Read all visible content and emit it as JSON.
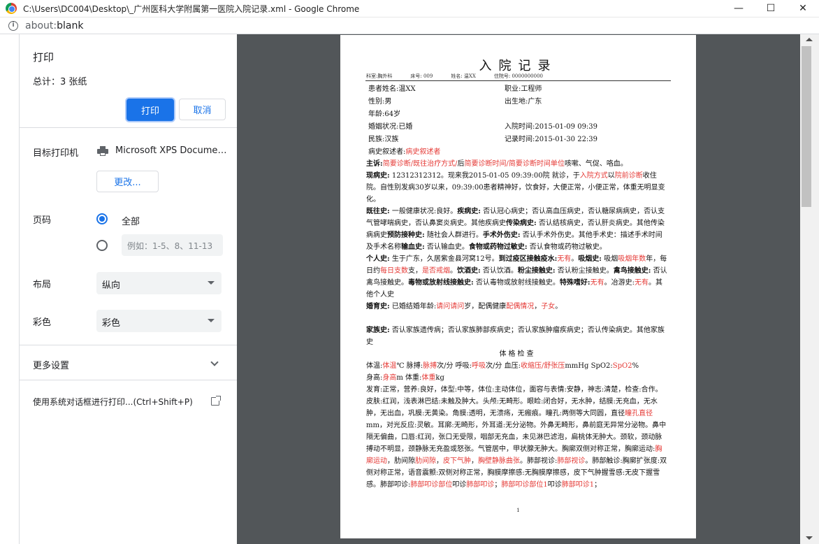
{
  "window": {
    "title": "C:\\Users\\DC004\\Desktop\\_广州医科大学附属第一医院入院记录.xml - Google Chrome",
    "minimize": "—",
    "maximize": "☐",
    "close": "✕"
  },
  "address": {
    "scheme": "about:",
    "path": "blank"
  },
  "print_panel": {
    "title": "打印",
    "total": "总计：3 张纸",
    "print_button": "打印",
    "cancel_button": "取消",
    "destination_label": "目标打印机",
    "printer_name": "Microsoft XPS Document Writer",
    "change_button": "更改...",
    "pages_label": "页码",
    "pages_all": "全部",
    "pages_placeholder": "例如：1-5、8、11-13",
    "layout_label": "布局",
    "layout_value": "纵向",
    "color_label": "彩色",
    "color_value": "彩色",
    "more_settings": "更多设置",
    "system_dialog": "使用系统对话框进行打印...(Ctrl+Shift+P)"
  },
  "document": {
    "title": "入院记录",
    "meta": [
      "科室:胸外科",
      "床号: 009",
      "姓名: 温XX",
      "住院号: 0000000000"
    ],
    "fields": {
      "name": "患者姓名:温XX",
      "job": "职业:工程师",
      "sex": "性别:男",
      "birthplace": "出生地:广东",
      "age": "年龄:64岁",
      "marital": "婚姻状况:已婚",
      "admit_time": "入院时间:2015-01-09 09:39",
      "ethnic": "民族:汉族",
      "record_time": "记录时间:2015-01-30 22:39",
      "narrator_label": "病史叙述者:",
      "narrator_value": "病史叙述者"
    },
    "page_number": "1"
  },
  "colors": {
    "accent": "#1a73e8",
    "preview_bg": "#525659",
    "doc_red": "#e53935"
  }
}
